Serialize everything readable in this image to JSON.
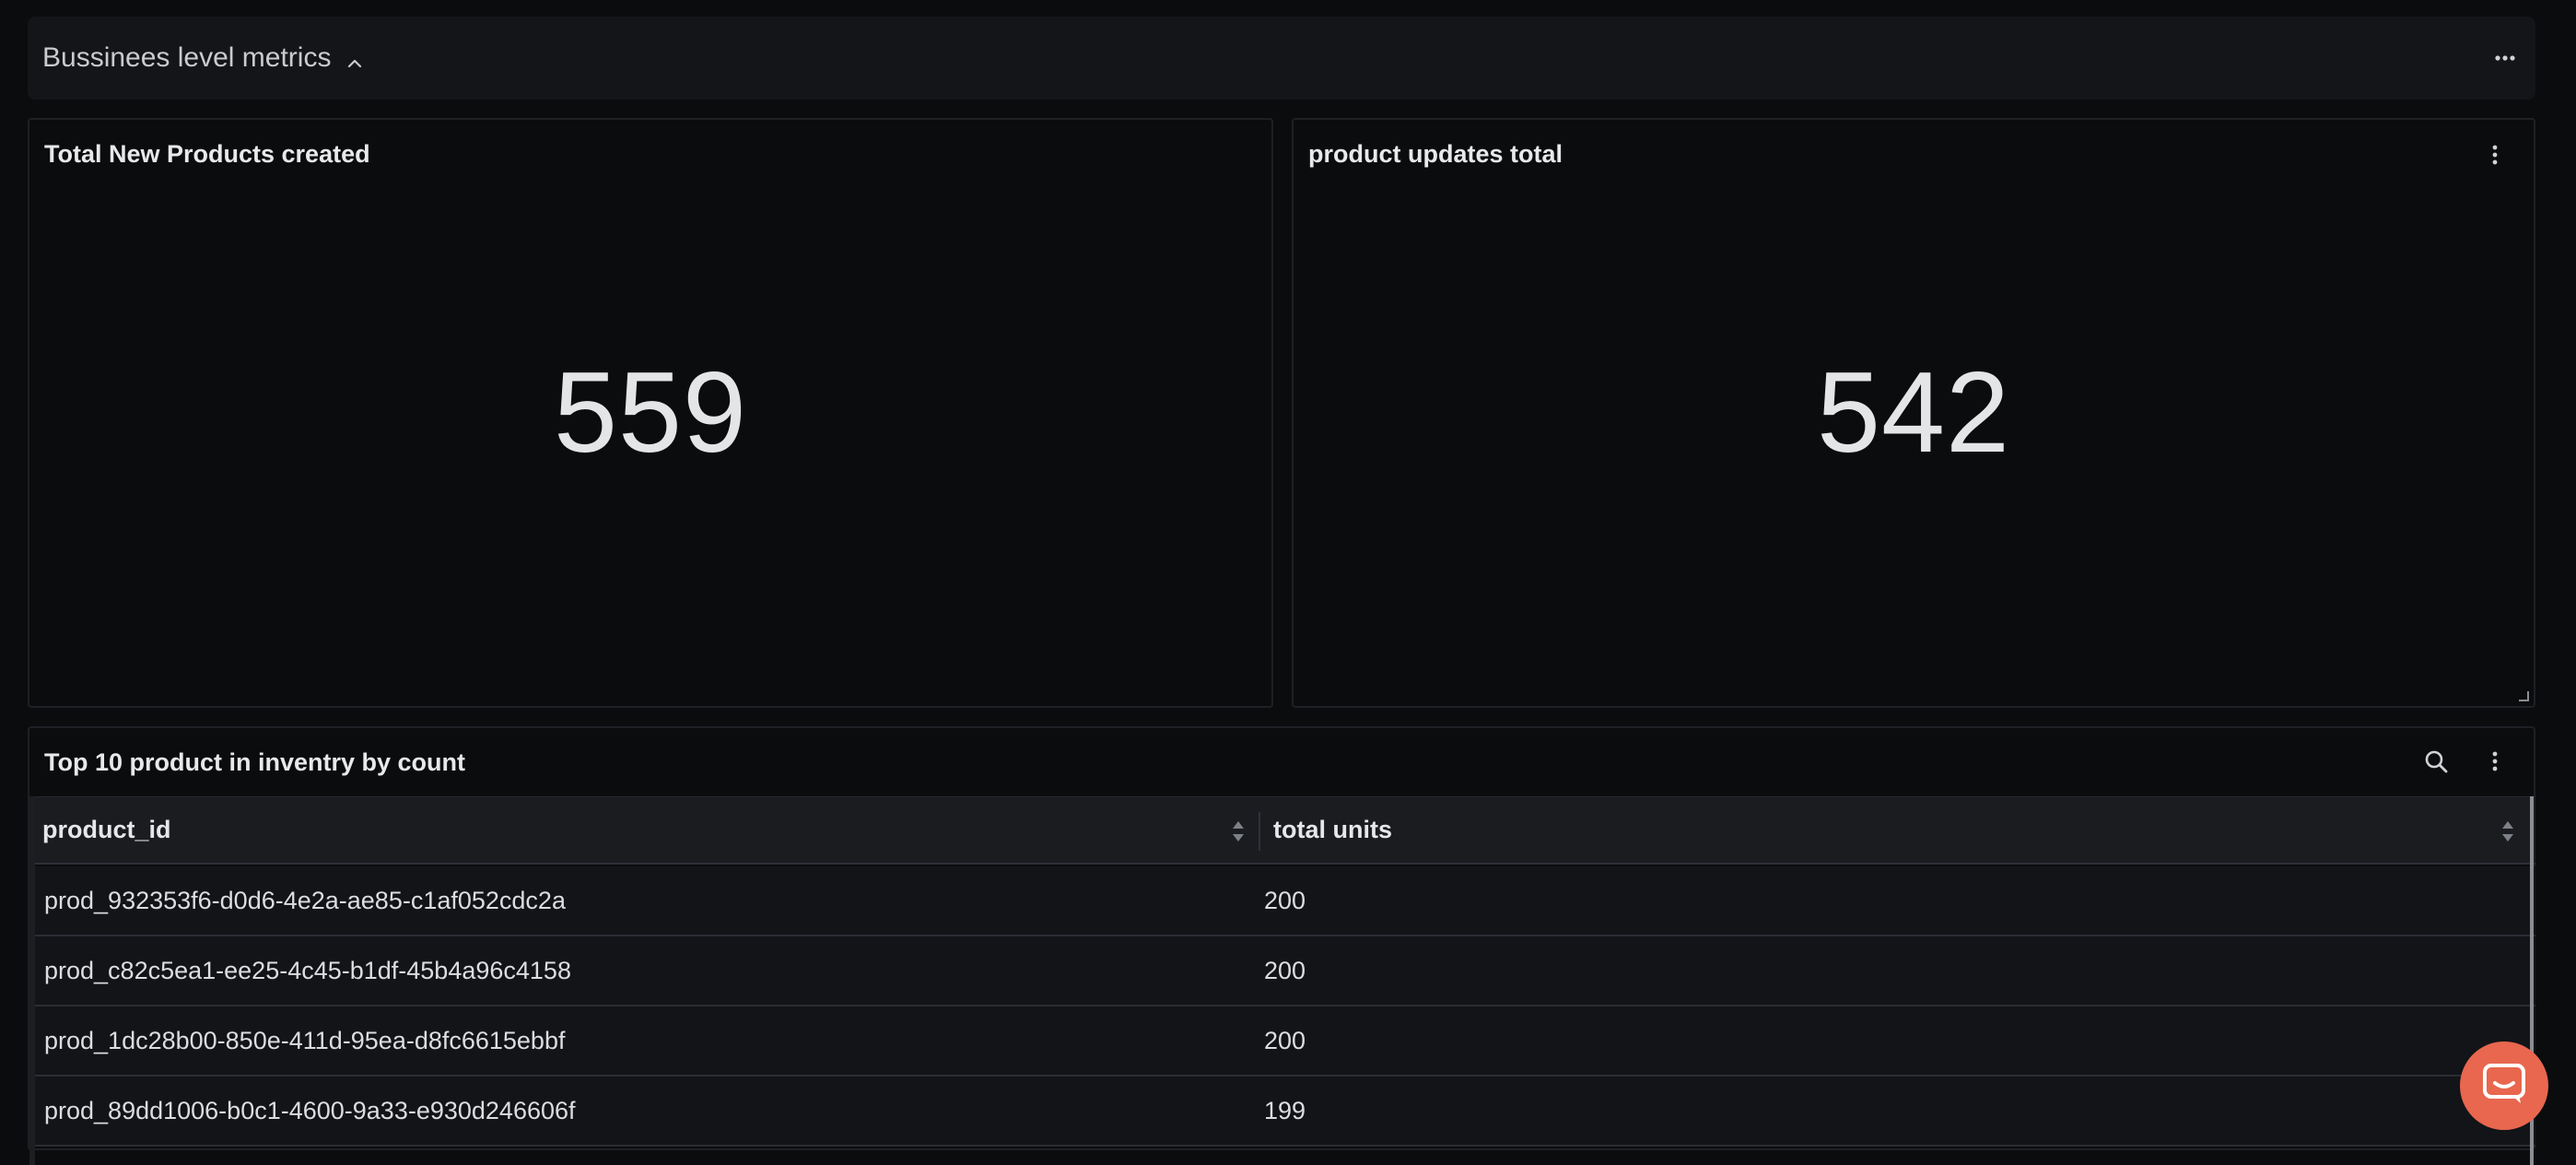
{
  "section": {
    "title": "Bussinees level metrics"
  },
  "panels": {
    "new_products": {
      "title": "Total New Products created",
      "value": "559"
    },
    "product_updates": {
      "title": "product updates total",
      "value": "542"
    }
  },
  "table": {
    "title": "Top 10 product in inventry by count",
    "columns": [
      "product_id",
      "total units"
    ],
    "rows": [
      [
        "prod_932353f6-d0d6-4e2a-ae85-c1af052cdc2a",
        "200"
      ],
      [
        "prod_c82c5ea1-ee25-4c45-b1df-45b4a96c4158",
        "200"
      ],
      [
        "prod_1dc28b00-850e-411d-95ea-d8fc6615ebbf",
        "200"
      ],
      [
        "prod_89dd1006-b0c1-4600-9a33-e930d246606f",
        "199"
      ]
    ]
  },
  "colors": {
    "background": "#0b0c0e",
    "chat_button": "#e8674e"
  },
  "icons": {
    "section_toggle": "chevron-up-icon",
    "section_menu": "more-horizontal-icon",
    "panel_menu": "more-vertical-icon",
    "table_search": "search-icon",
    "sort": "sort-icon",
    "chat": "chat-icon"
  }
}
